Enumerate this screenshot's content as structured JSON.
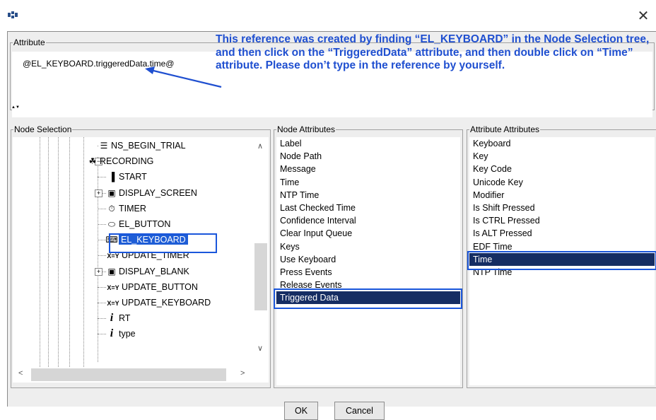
{
  "window": {
    "title": "",
    "close_glyph": "✕"
  },
  "attribute_section": {
    "legend": "Attribute",
    "value": "@EL_KEYBOARD.triggeredData.time@",
    "annotation": "This reference was created by finding “EL_KEYBOARD” in the Node Selection tree, and then click on the “TriggeredData” attribute, and then double click on “Time” attribute.  Please don’t type in the reference by yourself."
  },
  "node_selection": {
    "legend": "Node Selection",
    "items": [
      {
        "label": "NS_BEGIN_TRIAL",
        "icon": "sequence-icon",
        "glyph": "☰"
      },
      {
        "label": "RECORDING",
        "icon": "recording-icon",
        "glyph": "☘",
        "expander": "−"
      },
      {
        "label": "START",
        "icon": "start-icon",
        "glyph": "▐"
      },
      {
        "label": "DISPLAY_SCREEN",
        "icon": "display-icon",
        "glyph": "▣",
        "expander": "+"
      },
      {
        "label": "TIMER",
        "icon": "timer-icon",
        "glyph": "⏱"
      },
      {
        "label": "EL_BUTTON",
        "icon": "button-icon",
        "glyph": "⬭"
      },
      {
        "label": "EL_KEYBOARD",
        "icon": "keyboard-icon",
        "glyph": "⌨",
        "selected": true
      },
      {
        "label": "UPDATE_TIMER",
        "icon": "update-icon",
        "glyph": "X=Y"
      },
      {
        "label": "DISPLAY_BLANK",
        "icon": "display-icon",
        "glyph": "▣",
        "expander": "+"
      },
      {
        "label": "UPDATE_BUTTON",
        "icon": "update-icon",
        "glyph": "X=Y"
      },
      {
        "label": "UPDATE_KEYBOARD",
        "icon": "update-icon",
        "glyph": "X=Y"
      },
      {
        "label": "RT",
        "icon": "variable-icon",
        "glyph": "i"
      },
      {
        "label": "type",
        "icon": "variable-icon",
        "glyph": "i"
      }
    ],
    "scroll_up": "∧",
    "scroll_down": "∨",
    "scroll_left": "<",
    "scroll_right": ">"
  },
  "node_attributes": {
    "legend": "Node Attributes",
    "items": [
      "Label",
      "Node Path",
      "Message",
      "Time",
      "NTP Time",
      "Last Checked Time",
      "Confidence Interval",
      "Clear Input Queue",
      "Keys",
      "Use Keyboard",
      "Press Events",
      "Release Events",
      "Triggered Data"
    ],
    "selected_index": 12
  },
  "attribute_attributes": {
    "legend": "Attribute Attributes",
    "items": [
      "Keyboard",
      "Key",
      "Key Code",
      "Unicode Key",
      "Modifier",
      "Is Shift Pressed",
      "Is CTRL Pressed",
      "Is ALT Pressed",
      "EDF Time",
      "Time",
      "NTP Time"
    ],
    "selected_index": 9
  },
  "buttons": {
    "ok": "OK",
    "cancel": "Cancel"
  },
  "colors": {
    "annotation": "#1f4fd0",
    "highlight": "#1a56db",
    "selection": "#152d63",
    "tree_selection": "#1e5dd6"
  }
}
